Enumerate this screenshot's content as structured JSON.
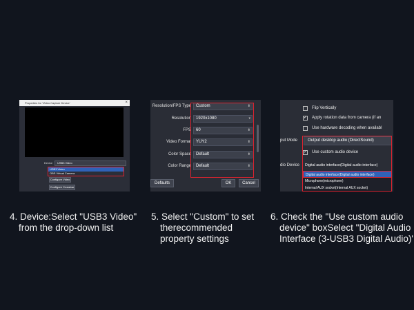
{
  "panel1": {
    "dialog_title": "Properties for 'Video Capture Device'",
    "close_glyph": "×",
    "device_label": "Device",
    "device_value": "USB3 Video",
    "dropdown_options": [
      "USB3 Video",
      "OBS Virtual Camera"
    ],
    "btn_configure_video": "Configure Video",
    "btn_configure_crossbar": "Configure Crossbar"
  },
  "panel2": {
    "rows": [
      {
        "label": "Resolution/FPS Type",
        "value": "Custom"
      },
      {
        "label": "Resolution",
        "value": "1920x1080"
      },
      {
        "label": "FPS",
        "value": "60"
      },
      {
        "label": "Video Format",
        "value": "YUY2"
      },
      {
        "label": "Color Space",
        "value": "Default"
      },
      {
        "label": "Color Range",
        "value": "Default"
      }
    ],
    "btn_defaults": "Defaults",
    "btn_ok": "OK",
    "btn_cancel": "Cancel"
  },
  "panel3": {
    "flip_vertically": "Flip Vertically",
    "apply_rotation": "Apply rotation data from camera (if an",
    "use_hw_decoding": "Use hardware decoding when availabl",
    "side_output_mode": "put Mode",
    "output_mode_value": "Output desktop audio (DirectSound)",
    "use_custom_audio": "Use custom audio device",
    "side_audio_device": "dio Device",
    "audio_device_value": "Digital audio interface(Digital audio interface)",
    "audio_options": [
      "Digital audio interface(Digital audio interface)",
      "Microphone(microphone)",
      "Internal AUX socket(Internal AUX socket)"
    ],
    "check_glyph": "✓"
  },
  "captions": {
    "step4_line1": "4. Device:Select \"USB3 Video\"",
    "step4_line2": "from the drop-down list",
    "step5_line1": "5. Select \"Custom\" to set",
    "step5_line2": "therecommended",
    "step5_line3": "property settings",
    "step6_line1": "6. Check the \"Use custom audio",
    "step6_line2": "device\" boxSelect \"Digital Audio",
    "step6_line3": "Interface (3-USB3 Digital Audio)'"
  },
  "colors": {
    "background": "#11151e",
    "highlight": "#e0232f",
    "selection": "#2f62b8"
  }
}
